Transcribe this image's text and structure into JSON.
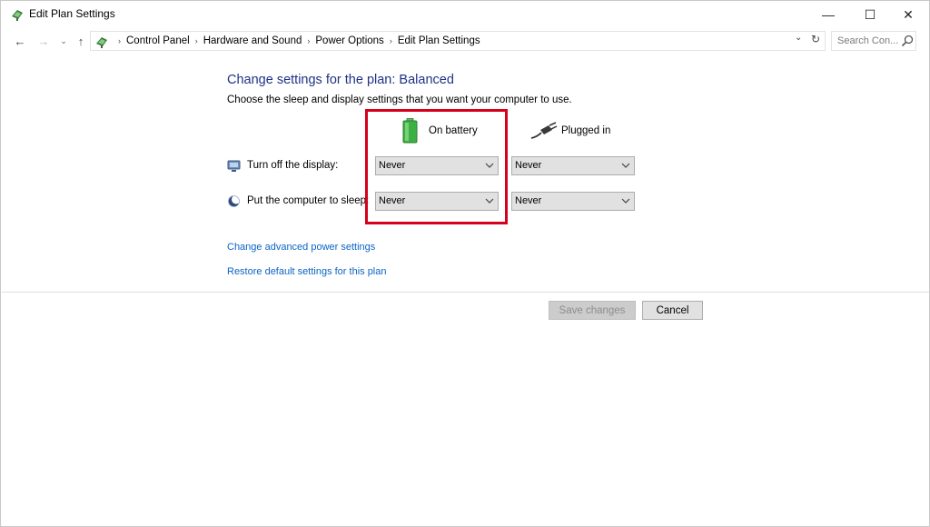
{
  "window": {
    "title": "Edit Plan Settings",
    "controls": {
      "minimize": "—",
      "maximize": "☐",
      "close": "✕"
    }
  },
  "address_bar": {
    "nav": {
      "back": "←",
      "forward": "→",
      "recent": "⌄",
      "up": "↑"
    },
    "breadcrumbs": [
      "Control Panel",
      "Hardware and Sound",
      "Power Options",
      "Edit Plan Settings"
    ],
    "separator": "›",
    "dropdown": "⌄",
    "refresh": "↻",
    "search_placeholder": "Search Con..."
  },
  "content": {
    "heading": "Change settings for the plan: Balanced",
    "subtitle": "Choose the sleep and display settings that you want your computer to use.",
    "columns": {
      "on_battery": "On battery",
      "plugged_in": "Plugged in"
    },
    "rows": [
      {
        "label": "Turn off the display:",
        "on_battery": "Never",
        "plugged_in": "Never"
      },
      {
        "label": "Put the computer to sleep:",
        "on_battery": "Never",
        "plugged_in": "Never"
      }
    ],
    "links": {
      "advanced": "Change advanced power settings",
      "restore": "Restore default settings for this plan"
    }
  },
  "buttons": {
    "save": "Save changes",
    "cancel": "Cancel"
  },
  "colors": {
    "heading": "#1e3287",
    "link": "#0b64c5",
    "highlight_box": "#d6001c",
    "battery_green": "#3cb043"
  },
  "icons": {
    "app": "power-plan-icon",
    "battery": "battery-icon",
    "plug": "plug-icon",
    "display": "monitor-icon",
    "sleep": "moon-icon",
    "search": "search-icon"
  }
}
